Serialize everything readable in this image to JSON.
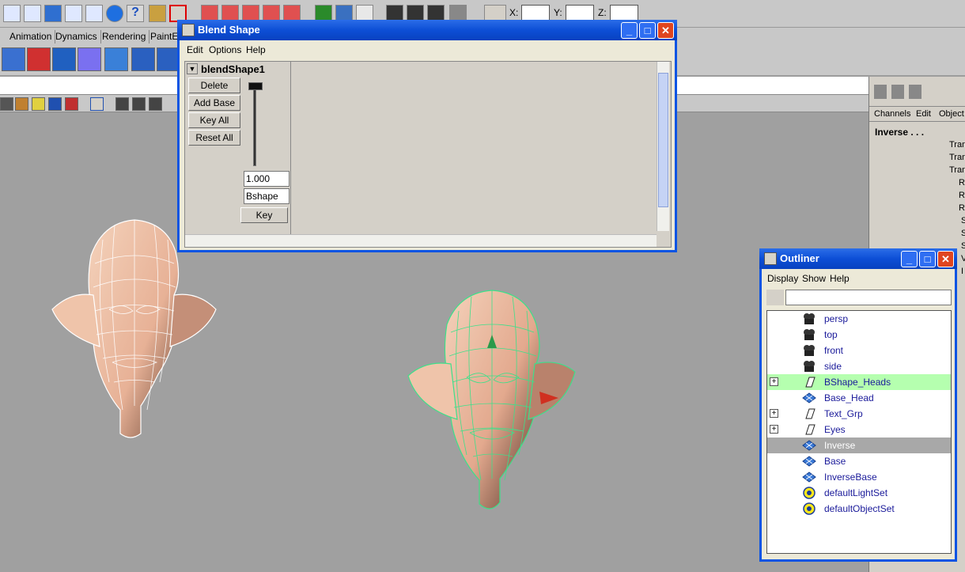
{
  "main": {
    "menu_tabs": [
      "Animation",
      "Dynamics",
      "Rendering",
      "PaintE"
    ],
    "coord_labels": [
      "X:",
      "Y:",
      "Z:"
    ]
  },
  "channel_box": {
    "menu": [
      "Channels",
      "Edit",
      "Object"
    ],
    "object_name": "Inverse . . .",
    "attrs": [
      "Tran",
      "Tran",
      "Tran",
      "R",
      "R",
      "R",
      "S",
      "S",
      "S",
      "V",
      "I"
    ]
  },
  "blend_shape": {
    "title": "Blend Shape",
    "menu": [
      "Edit",
      "Options",
      "Help"
    ],
    "node_name": "blendShape1",
    "buttons": {
      "delete": "Delete",
      "add_base": "Add Base",
      "key_all": "Key All",
      "reset_all": "Reset All",
      "key": "Key"
    },
    "weight_value": "1.000",
    "target_name": "Bshape",
    "slider_value": 1.0
  },
  "outliner": {
    "title": "Outliner",
    "menu": [
      "Display",
      "Show",
      "Help"
    ],
    "items": [
      {
        "label": "persp",
        "icon": "camera-icon",
        "expandable": false,
        "state": ""
      },
      {
        "label": "top",
        "icon": "camera-icon",
        "expandable": false,
        "state": ""
      },
      {
        "label": "front",
        "icon": "camera-icon",
        "expandable": false,
        "state": ""
      },
      {
        "label": "side",
        "icon": "camera-icon",
        "expandable": false,
        "state": ""
      },
      {
        "label": "BShape_Heads",
        "icon": "group-icon",
        "expandable": true,
        "state": "selected"
      },
      {
        "label": "Base_Head",
        "icon": "mesh-icon",
        "expandable": false,
        "state": ""
      },
      {
        "label": "Text_Grp",
        "icon": "group-icon",
        "expandable": true,
        "state": ""
      },
      {
        "label": "Eyes",
        "icon": "group-icon",
        "expandable": true,
        "state": ""
      },
      {
        "label": "Inverse",
        "icon": "mesh-icon",
        "expandable": false,
        "state": "current"
      },
      {
        "label": "Base",
        "icon": "mesh-icon",
        "expandable": false,
        "state": ""
      },
      {
        "label": "InverseBase",
        "icon": "mesh-icon",
        "expandable": false,
        "state": ""
      },
      {
        "label": "defaultLightSet",
        "icon": "set-icon",
        "expandable": false,
        "state": ""
      },
      {
        "label": "defaultObjectSet",
        "icon": "set-icon",
        "expandable": false,
        "state": ""
      }
    ]
  },
  "colors": {
    "title_blue": "#0d4fd6",
    "viewport_gray": "#a0a0a0",
    "selected_green": "#b5ffaf",
    "wireframe_green": "#3de08a"
  }
}
